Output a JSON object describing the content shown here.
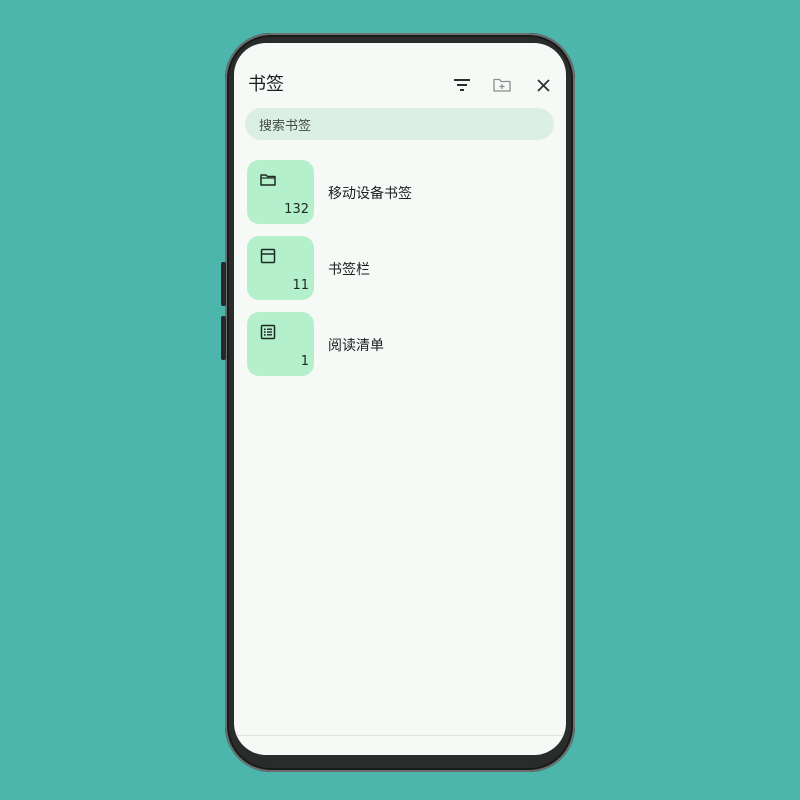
{
  "header": {
    "title": "书签",
    "icons": [
      "filter-icon",
      "new-folder-icon",
      "close-icon"
    ]
  },
  "search": {
    "placeholder": "搜索书签"
  },
  "folders": [
    {
      "label": "移动设备书签",
      "count": "132",
      "icon": "folder-icon"
    },
    {
      "label": "书签栏",
      "count": "11",
      "icon": "bookmark-bar-icon"
    },
    {
      "label": "阅读清单",
      "count": "1",
      "icon": "reading-list-icon"
    }
  ],
  "colors": {
    "background": "#4db6ac",
    "screen": "#f6faf7",
    "search_bg": "#dcefe4",
    "tile": "#b3f0cb"
  }
}
